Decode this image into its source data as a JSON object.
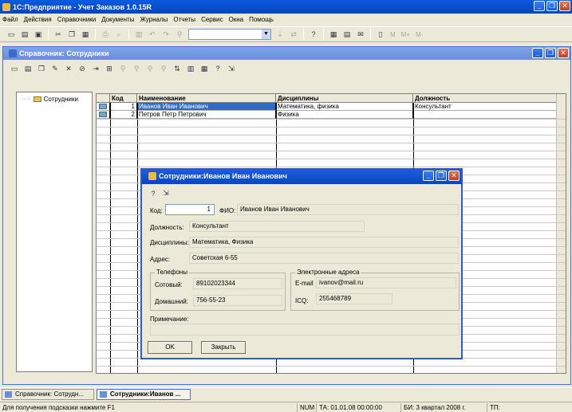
{
  "app": {
    "title": "1С:Предприятие - Учет Заказов 1.0.15R"
  },
  "menu": [
    "Файл",
    "Действия",
    "Справочники",
    "Документы",
    "Журналы",
    "Отчеты",
    "Сервис",
    "Окна",
    "Помощь"
  ],
  "toolbar": {
    "m_labels": [
      "M",
      "M+",
      "M-"
    ]
  },
  "child_window": {
    "title": "Справочник: Сотрудники",
    "tree": {
      "root_label": "Сотрудники"
    },
    "grid": {
      "columns": [
        "Код",
        "Наименование",
        "Дисциплины",
        "Должность"
      ],
      "rows": [
        {
          "code": "1",
          "name": "Иванов Иван Иванович",
          "disciplines": "Математика, физика",
          "position": "Консультант",
          "selected": true
        },
        {
          "code": "2",
          "name": "Петров Петр Петрович",
          "disciplines": "Физика",
          "position": "",
          "selected": false
        }
      ]
    }
  },
  "dialog": {
    "title": "Сотрудники:Иванов Иван Иванович",
    "code_label": "Код:",
    "code_value": "1",
    "fio_label": "ФИО:",
    "fio_value": "Иванов Иван Иванович",
    "position_label": "Должность:",
    "position_value": "Консультант",
    "disciplines_label": "Дисциплины:",
    "disciplines_value": "Математика, Физика",
    "address_label": "Адрес:",
    "address_value": "Советская 6-55",
    "phones_group": "Телефоны",
    "mobile_label": "Сотовый:",
    "mobile_value": "89102023344",
    "home_label": "Домашний:",
    "home_value": "756-55-23",
    "email_group": "Электронные адреса",
    "email_label": "E-mail",
    "email_value": "ivanov@mail.ru",
    "icq_label": "ICQ:",
    "icq_value": "255468789",
    "note_label": "Примечание:",
    "note_value": "",
    "ok_label": "OK",
    "close_label": "Закрыть"
  },
  "taskbar": [
    {
      "label": "Справочник: Сотрудн...",
      "active": false
    },
    {
      "label": "Сотрудники:Иванов ...",
      "active": true
    }
  ],
  "status": {
    "hint": "Для получения подсказки нажмите F1",
    "num": "NUM",
    "ta": "ТА: 01.01.08  00:00:00",
    "bi": "БИ: 3 квартал 2008 г.",
    "tp": "ТП:"
  }
}
